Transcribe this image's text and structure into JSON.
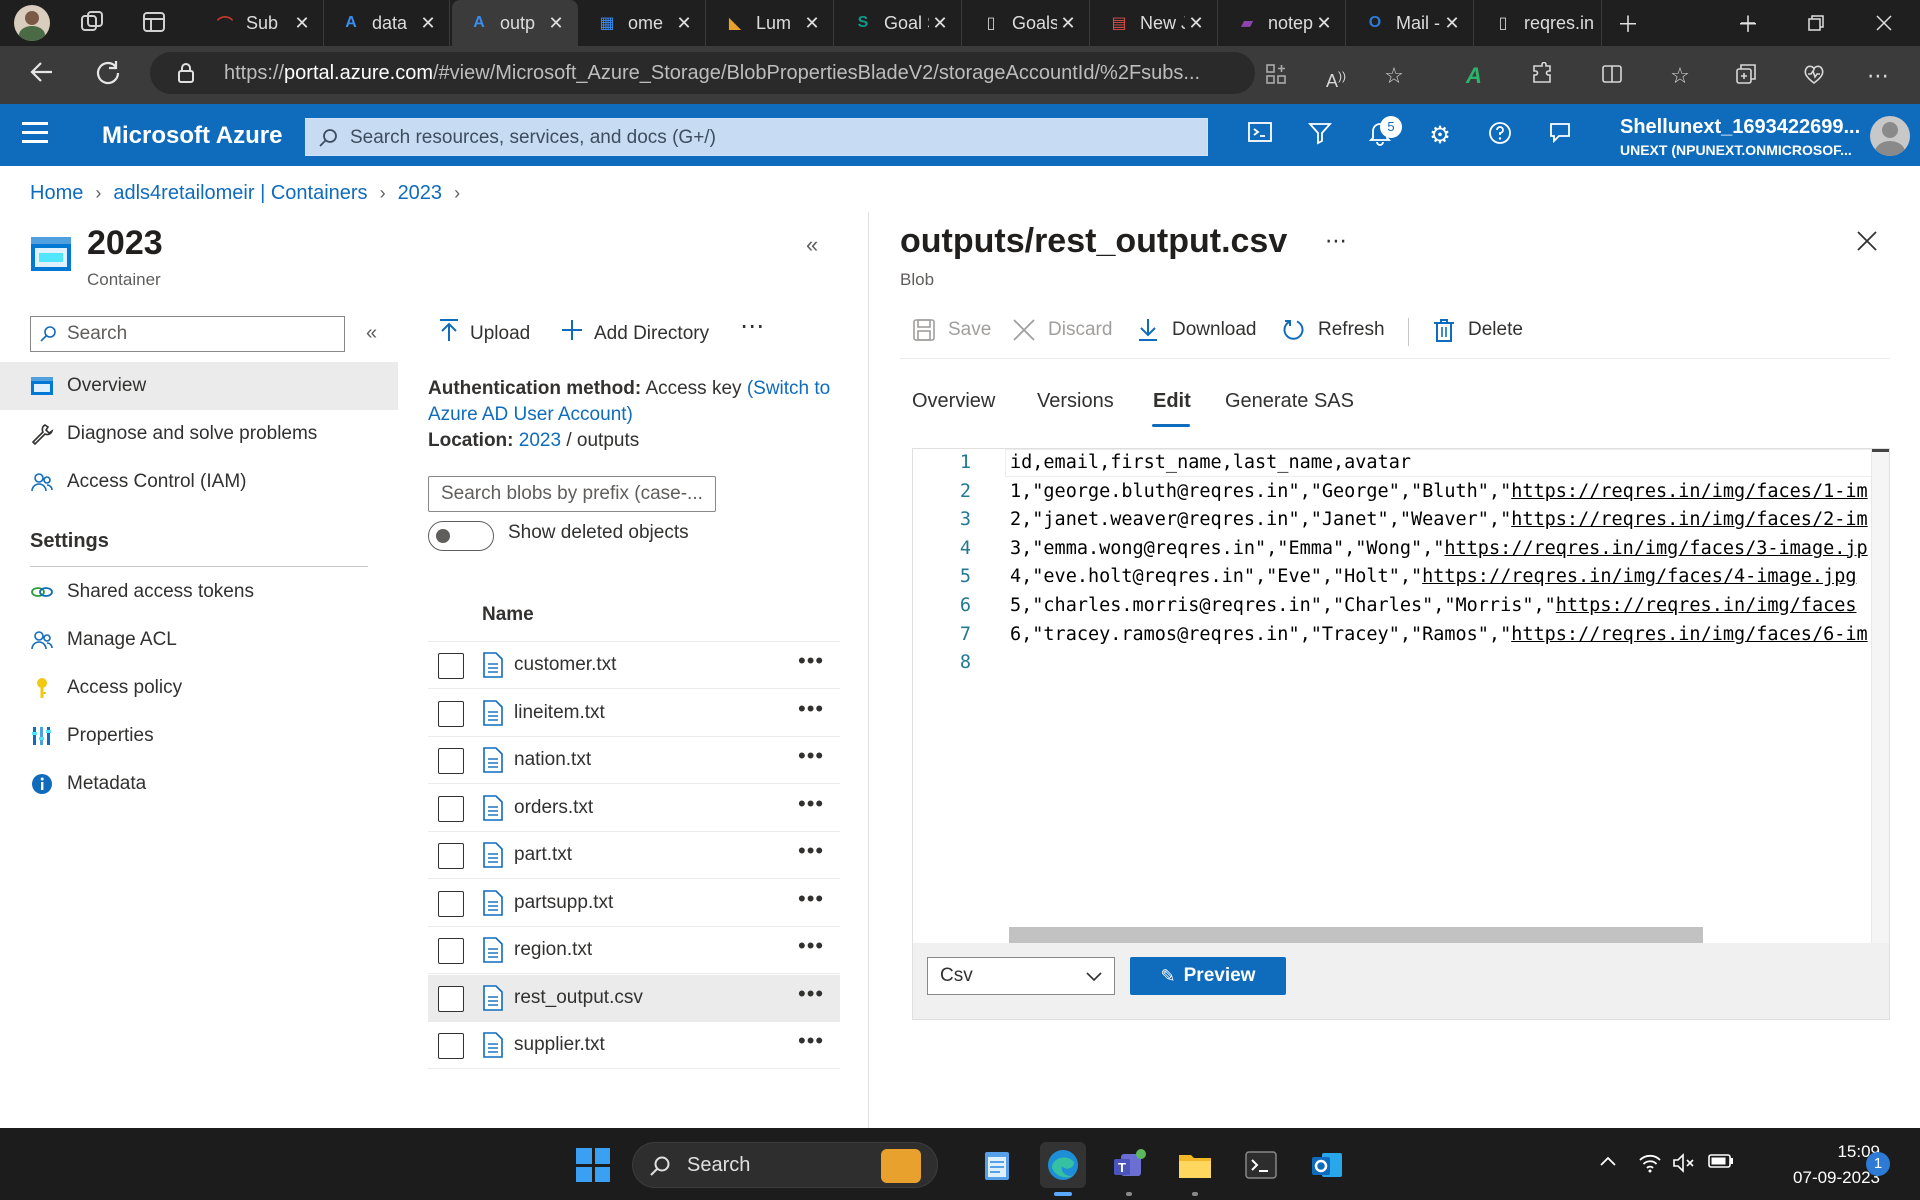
{
  "browser": {
    "tabs": [
      {
        "title": "Sub",
        "icon": "subscription-icon",
        "active": false
      },
      {
        "title": "data",
        "icon": "azure-icon",
        "active": false
      },
      {
        "title": "outp",
        "icon": "azure-icon",
        "active": true
      },
      {
        "title": "ome",
        "icon": "storage-icon",
        "active": false
      },
      {
        "title": "Lum",
        "icon": "lumen-icon",
        "active": false
      },
      {
        "title": "Goal Sett",
        "icon": "sharepoint-icon",
        "active": false
      },
      {
        "title": "Goals Pla",
        "icon": "document-icon",
        "active": false
      },
      {
        "title": "New Join",
        "icon": "pdf-icon",
        "active": false
      },
      {
        "title": "notepad",
        "icon": "onenote-icon",
        "active": false
      },
      {
        "title": "Mail - Fa",
        "icon": "outlook-icon",
        "active": false
      },
      {
        "title": "reqres.in",
        "icon": "document-icon",
        "active": false
      }
    ],
    "url_host": "portal.azure.com",
    "url_prefix": "https://",
    "url_path": "/#view/Microsoft_Azure_Storage/BlobPropertiesBladeV2/storageAccountId/%2Fsubs..."
  },
  "azure": {
    "brand": "Microsoft Azure",
    "search_placeholder": "Search resources, services, and docs (G+/)",
    "notification_count": "5",
    "account_name": "Shellunext_1693422699...",
    "account_tenant": "UNEXT (NPUNEXT.ONMICROSOF..."
  },
  "breadcrumb": [
    "Home",
    "adls4retailomeir | Containers",
    "2023"
  ],
  "container": {
    "title": "2023",
    "subtitle": "Container",
    "search_placeholder": "Search",
    "menu": [
      {
        "label": "Overview",
        "icon": "overview-icon",
        "active": true
      },
      {
        "label": "Diagnose and solve problems",
        "icon": "wrench-icon",
        "active": false
      },
      {
        "label": "Access Control (IAM)",
        "icon": "people-icon",
        "active": false
      }
    ],
    "settings_heading": "Settings",
    "settings_menu": [
      {
        "label": "Shared access tokens",
        "icon": "link-icon"
      },
      {
        "label": "Manage ACL",
        "icon": "people-icon"
      },
      {
        "label": "Access policy",
        "icon": "key-icon"
      },
      {
        "label": "Properties",
        "icon": "properties-icon"
      },
      {
        "label": "Metadata",
        "icon": "info-icon"
      }
    ]
  },
  "browser_blade": {
    "upload_label": "Upload",
    "add_directory_label": "Add Directory",
    "auth_label": "Authentication method:",
    "auth_value": "Access key",
    "auth_switch_1": "(Switch to",
    "auth_switch_2": "Azure AD User Account)",
    "location_label": "Location:",
    "location_link": "2023",
    "location_sep": "/",
    "location_folder": "outputs",
    "blob_search_placeholder": "Search blobs by prefix (case-...",
    "show_deleted_label": "Show deleted objects",
    "column_name": "Name",
    "files": [
      "customer.txt",
      "lineitem.txt",
      "nation.txt",
      "orders.txt",
      "part.txt",
      "partsupp.txt",
      "region.txt",
      "rest_output.csv",
      "supplier.txt"
    ],
    "selected_file": "rest_output.csv"
  },
  "blob": {
    "title": "outputs/rest_output.csv",
    "subtitle": "Blob",
    "commands": {
      "save": "Save",
      "discard": "Discard",
      "download": "Download",
      "refresh": "Refresh",
      "delete": "Delete"
    },
    "tabs": [
      "Overview",
      "Versions",
      "Edit",
      "Generate SAS"
    ],
    "active_tab": "Edit",
    "lines": [
      {
        "n": "1",
        "pre": "id,email,first_name,last_name,avatar",
        "url": ""
      },
      {
        "n": "2",
        "pre": "1,\"george.bluth@reqres.in\",\"George\",\"Bluth\",\"",
        "url": "https://reqres.in/img/faces/1-im"
      },
      {
        "n": "3",
        "pre": "2,\"janet.weaver@reqres.in\",\"Janet\",\"Weaver\",\"",
        "url": "https://reqres.in/img/faces/2-im"
      },
      {
        "n": "4",
        "pre": "3,\"emma.wong@reqres.in\",\"Emma\",\"Wong\",\"",
        "url": "https://reqres.in/img/faces/3-image.jp"
      },
      {
        "n": "5",
        "pre": "4,\"eve.holt@reqres.in\",\"Eve\",\"Holt\",\"",
        "url": "https://reqres.in/img/faces/4-image.jpg"
      },
      {
        "n": "6",
        "pre": "5,\"charles.morris@reqres.in\",\"Charles\",\"Morris\",\"",
        "url": "https://reqres.in/img/faces"
      },
      {
        "n": "7",
        "pre": "6,\"tracey.ramos@reqres.in\",\"Tracey\",\"Ramos\",\"",
        "url": "https://reqres.in/img/faces/6-im"
      },
      {
        "n": "8",
        "pre": "",
        "url": ""
      }
    ],
    "language": "Csv",
    "preview_label": "Preview"
  },
  "taskbar": {
    "search_label": "Search",
    "time": "15:09",
    "date": "07-09-2023",
    "notification_count": "1"
  }
}
